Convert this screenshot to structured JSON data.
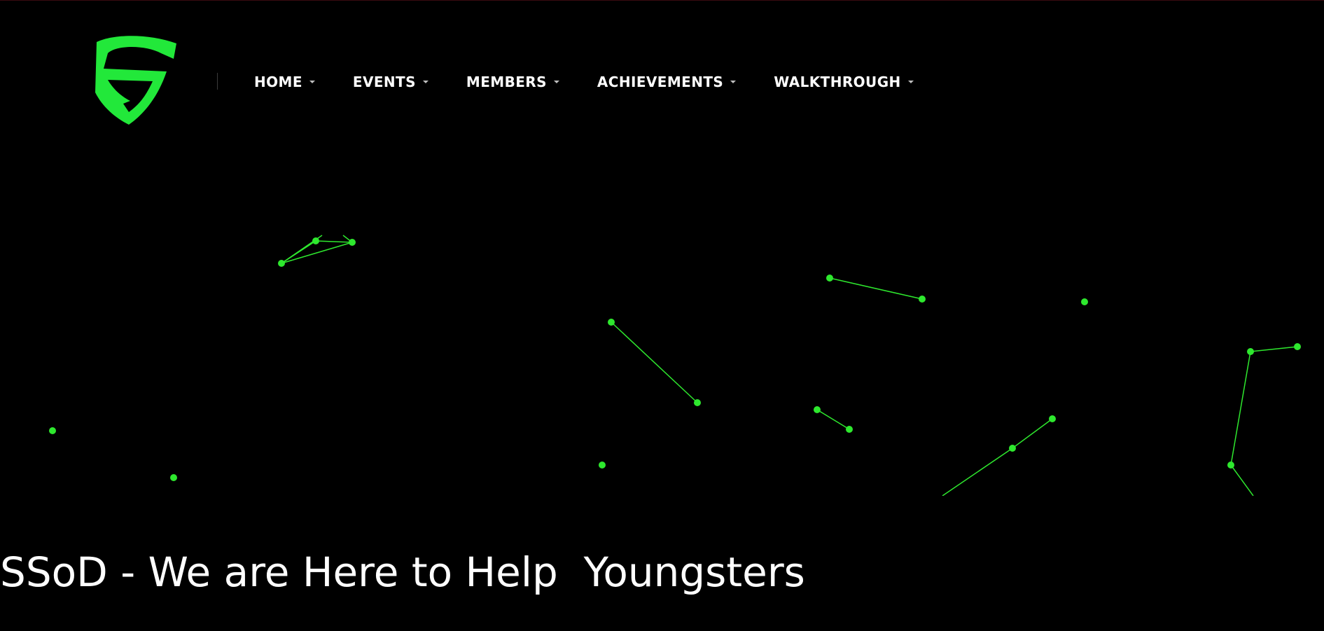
{
  "brand": {
    "logo_icon": "ssod-shield-logo-icon",
    "logo_color": "#22e83a"
  },
  "nav": {
    "items": [
      {
        "label": "HOME",
        "icon": "caret-down-icon"
      },
      {
        "label": "EVENTS",
        "icon": "caret-down-icon"
      },
      {
        "label": "MEMBERS",
        "icon": "caret-down-icon"
      },
      {
        "label": "ACHIEVEMENTS",
        "icon": "caret-down-icon"
      },
      {
        "label": "WALKTHROUGH",
        "icon": "caret-down-icon"
      }
    ]
  },
  "hero": {
    "title": "SSoD - We are Here to Help  Youngsters"
  },
  "particles": {
    "color": "#2ee82e"
  }
}
